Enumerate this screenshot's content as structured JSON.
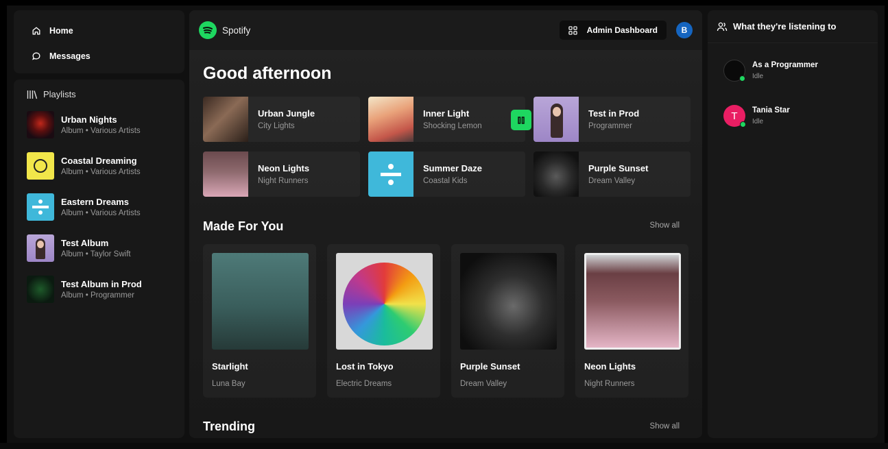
{
  "nav": {
    "home": "Home",
    "messages": "Messages"
  },
  "playlists": {
    "header": "Playlists",
    "items": [
      {
        "title": "Urban Nights",
        "subtitle": "Album • Various Artists"
      },
      {
        "title": "Coastal Dreaming",
        "subtitle": "Album • Various Artists"
      },
      {
        "title": "Eastern Dreams",
        "subtitle": "Album • Various Artists"
      },
      {
        "title": "Test Album",
        "subtitle": "Album • Taylor Swift"
      },
      {
        "title": "Test Album in Prod",
        "subtitle": "Album • Programmer"
      }
    ]
  },
  "topbar": {
    "brand": "Spotify",
    "admin": "Admin Dashboard",
    "avatar": "B"
  },
  "main": {
    "greeting": "Good afternoon",
    "quick": [
      {
        "title": "Urban Jungle",
        "subtitle": "City Lights"
      },
      {
        "title": "Inner Light",
        "subtitle": "Shocking Lemon"
      },
      {
        "title": "Test in Prod",
        "subtitle": "Programmer"
      },
      {
        "title": "Neon Lights",
        "subtitle": "Night Runners"
      },
      {
        "title": "Summer Daze",
        "subtitle": "Coastal Kids"
      },
      {
        "title": "Purple Sunset",
        "subtitle": "Dream Valley"
      }
    ],
    "made_for_you": {
      "title": "Made For You",
      "show_all": "Show all",
      "cards": [
        {
          "title": "Starlight",
          "subtitle": "Luna Bay"
        },
        {
          "title": "Lost in Tokyo",
          "subtitle": "Electric Dreams"
        },
        {
          "title": "Purple Sunset",
          "subtitle": "Dream Valley"
        },
        {
          "title": "Neon Lights",
          "subtitle": "Night Runners"
        }
      ]
    },
    "trending": {
      "title": "Trending",
      "show_all": "Show all"
    }
  },
  "friends": {
    "header": "What they're listening to",
    "list": [
      {
        "name": "As a Programmer",
        "status": "Idle"
      },
      {
        "name": "Tania Star",
        "status": "Idle",
        "initial": "T"
      }
    ]
  },
  "colors": {
    "accent": "#1ed760",
    "avatar_blue": "#1565c0",
    "avatar_pink": "#e91e63"
  }
}
